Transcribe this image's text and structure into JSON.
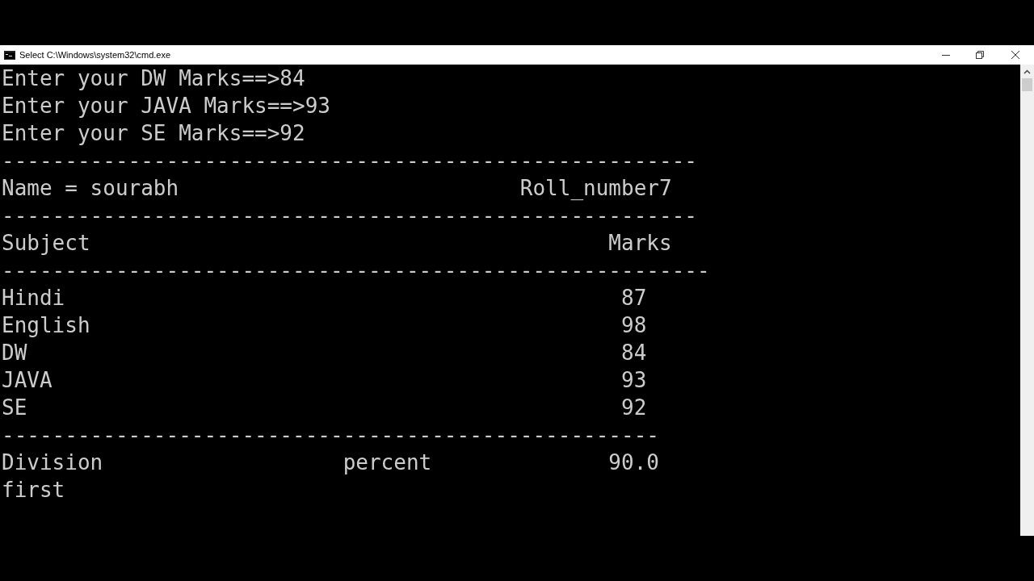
{
  "window": {
    "title": "Select C:\\Windows\\system32\\cmd.exe"
  },
  "console": [
    {
      "kind": "text",
      "cells": [
        "Enter your DW Marks==>84"
      ]
    },
    {
      "kind": "text",
      "cells": [
        "Enter your JAVA Marks==>93"
      ]
    },
    {
      "kind": "text",
      "cells": [
        "Enter your SE Marks==>92"
      ]
    },
    {
      "kind": "text",
      "cells": [
        "-------------------------------------------------------"
      ]
    },
    {
      "kind": "pair",
      "cells": [
        "Name = sourabh",
        "Roll_number7"
      ]
    },
    {
      "kind": "text",
      "cells": [
        "-------------------------------------------------------"
      ]
    },
    {
      "kind": "header",
      "cells": [
        "Subject",
        "Marks"
      ]
    },
    {
      "kind": "text",
      "cells": [
        "--------------------------------------------------------"
      ]
    },
    {
      "kind": "mark",
      "cells": [
        "Hindi",
        "87"
      ]
    },
    {
      "kind": "mark",
      "cells": [
        "English",
        "98"
      ]
    },
    {
      "kind": "mark",
      "cells": [
        "DW",
        "84"
      ]
    },
    {
      "kind": "mark",
      "cells": [
        "JAVA",
        "93"
      ]
    },
    {
      "kind": "mark",
      "cells": [
        "SE",
        "92"
      ]
    },
    {
      "kind": "text",
      "cells": [
        "----------------------------------------------------"
      ]
    },
    {
      "kind": "summary",
      "cells": [
        "Division",
        "percent",
        "90.0"
      ]
    },
    {
      "kind": "text",
      "cells": [
        "first"
      ]
    }
  ]
}
